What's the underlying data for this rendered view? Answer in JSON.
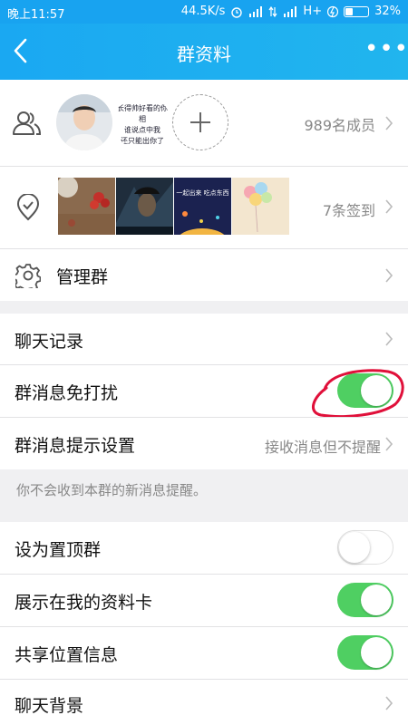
{
  "status_bar": {
    "time": "晚上11:57",
    "net_speed": "44.5K/s",
    "network": "H+",
    "battery": "32%",
    "battery_level": 0.32
  },
  "nav": {
    "title": "群资料",
    "more_label": "•••"
  },
  "members": {
    "count_label": "989名成员",
    "meme_text": [
      "长得帅好看的你相",
      "谁说点中我",
      "还只能出你了"
    ]
  },
  "checkin": {
    "count_label": "7条签到",
    "thumb3_text": "一起出来 吃点东西"
  },
  "manage": {
    "label": "管理群"
  },
  "settings": {
    "chat_history": "聊天记录",
    "dnd": "群消息免打扰",
    "dnd_on": true,
    "notify": "群消息提示设置",
    "notify_value": "接收消息但不提醒",
    "note": "你不会收到本群的新消息提醒。",
    "pin": "设为置顶群",
    "pin_on": false,
    "show_card": "展示在我的资料卡",
    "show_card_on": true,
    "share_loc": "共享位置信息",
    "share_loc_on": true,
    "background": "聊天背景"
  },
  "colors": {
    "header": "#18a3f0",
    "toggle_on": "#4fcf62",
    "annotation": "#e0103a"
  }
}
